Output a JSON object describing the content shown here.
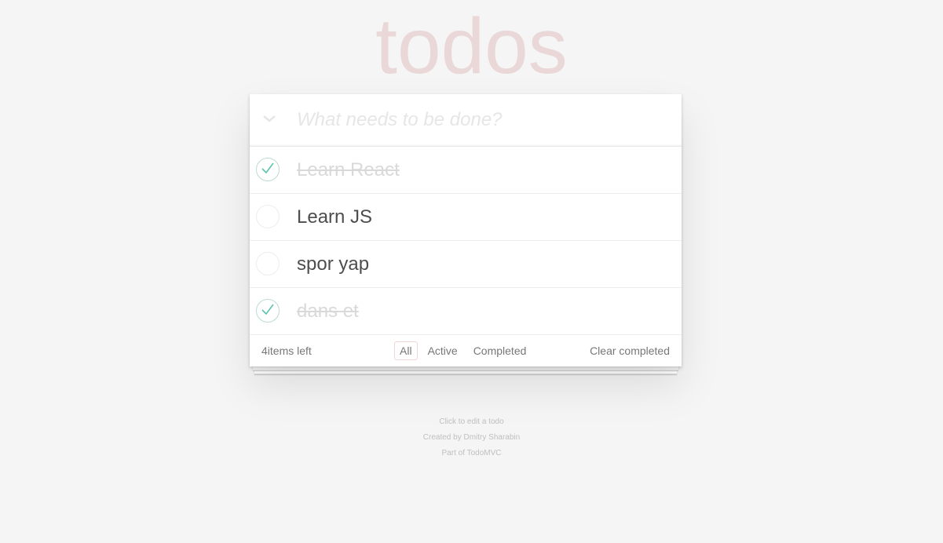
{
  "app": {
    "title": "todos"
  },
  "header": {
    "new_todo_placeholder": "What needs to be done?"
  },
  "todos": [
    {
      "label": "Learn React",
      "completed": true
    },
    {
      "label": "Learn JS",
      "completed": false
    },
    {
      "label": "spor yap",
      "completed": false
    },
    {
      "label": "dans et",
      "completed": true
    }
  ],
  "footer": {
    "count_label": "4items left",
    "filters": [
      {
        "label": "All",
        "selected": true
      },
      {
        "label": "Active",
        "selected": false
      },
      {
        "label": "Completed",
        "selected": false
      }
    ],
    "clear_completed_label": "Clear completed"
  },
  "info": {
    "line1": "Click to edit a todo",
    "line2": "Created by Dmitry Sharabin",
    "line3": "Part of TodoMVC"
  },
  "colors": {
    "background": "#f5f5f5",
    "title": "rgba(175,47,47,0.15)",
    "check": "#5dc2af"
  }
}
